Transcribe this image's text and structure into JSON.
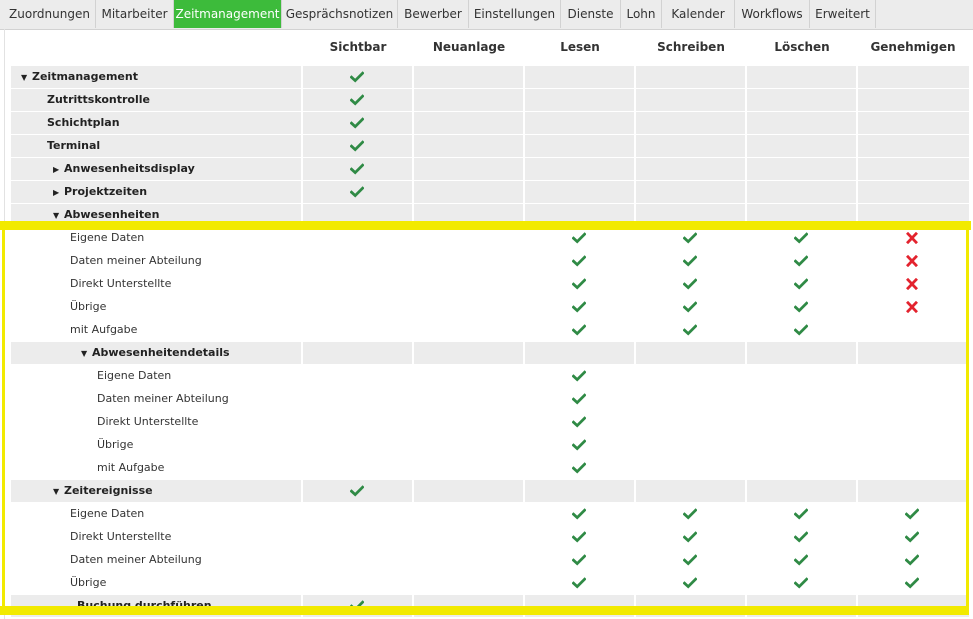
{
  "tabs": [
    "Zuordnungen",
    "Mitarbeiter",
    "Zeitmanagement",
    "Gesprächsnotizen",
    "Bewerber",
    "Einstellungen",
    "Dienste",
    "Lohn",
    "Kalender",
    "Workflows",
    "Erweitert"
  ],
  "active_tab": "Zeitmanagement",
  "columns": [
    "Sichtbar",
    "Neuanlage",
    "Lesen",
    "Schreiben",
    "Löschen",
    "Genehmigen"
  ],
  "colors": {
    "accent": "#3dbb3b",
    "check": "#2f8a45",
    "cross": "#e3232e",
    "highlight": "#f2ea00",
    "row_shade": "#ececec"
  },
  "rows": [
    {
      "label": "Zeitmanagement",
      "level": 0,
      "bold": true,
      "expander": "expanded",
      "shaded": true,
      "cells": [
        "check",
        "",
        "",
        "",
        "",
        ""
      ]
    },
    {
      "label": "Zutrittskontrolle",
      "level": 1,
      "bold": true,
      "expander": "none",
      "shaded": true,
      "cells": [
        "check",
        "",
        "",
        "",
        "",
        ""
      ]
    },
    {
      "label": "Schichtplan",
      "level": 1,
      "bold": true,
      "expander": "none",
      "shaded": true,
      "cells": [
        "check",
        "",
        "",
        "",
        "",
        ""
      ]
    },
    {
      "label": "Terminal",
      "level": 1,
      "bold": true,
      "expander": "none",
      "shaded": true,
      "cells": [
        "check",
        "",
        "",
        "",
        "",
        ""
      ]
    },
    {
      "label": "Anwesenheitsdisplay",
      "level": 2,
      "bold": true,
      "expander": "collapsed",
      "shaded": true,
      "cells": [
        "check",
        "",
        "",
        "",
        "",
        ""
      ]
    },
    {
      "label": "Projektzeiten",
      "level": 2,
      "bold": true,
      "expander": "collapsed",
      "shaded": true,
      "cells": [
        "check",
        "",
        "",
        "",
        "",
        ""
      ]
    },
    {
      "label": "Abwesenheiten",
      "level": 2,
      "bold": true,
      "expander": "expanded",
      "shaded": true,
      "cells": [
        "",
        "",
        "",
        "",
        "",
        ""
      ]
    },
    {
      "label": "Eigene Daten",
      "level": 3,
      "bold": false,
      "expander": "none",
      "shaded": false,
      "cells": [
        "",
        "",
        "check",
        "check",
        "check",
        "cross"
      ]
    },
    {
      "label": "Daten meiner Abteilung",
      "level": 3,
      "bold": false,
      "expander": "none",
      "shaded": false,
      "cells": [
        "",
        "",
        "check",
        "check",
        "check",
        "cross"
      ]
    },
    {
      "label": "Direkt Unterstellte",
      "level": 3,
      "bold": false,
      "expander": "none",
      "shaded": false,
      "cells": [
        "",
        "",
        "check",
        "check",
        "check",
        "cross"
      ]
    },
    {
      "label": "Übrige",
      "level": 3,
      "bold": false,
      "expander": "none",
      "shaded": false,
      "cells": [
        "",
        "",
        "check",
        "check",
        "check",
        "cross"
      ]
    },
    {
      "label": "mit Aufgabe",
      "level": 3,
      "bold": false,
      "expander": "none",
      "shaded": false,
      "cells": [
        "",
        "",
        "check",
        "check",
        "check",
        ""
      ]
    },
    {
      "label": "Abwesenheitendetails",
      "level": 4,
      "bold": true,
      "expander": "expanded",
      "shaded": true,
      "cells": [
        "",
        "",
        "",
        "",
        "",
        ""
      ]
    },
    {
      "label": "Eigene Daten",
      "level": 5,
      "bold": false,
      "expander": "none",
      "shaded": false,
      "cells": [
        "",
        "",
        "check",
        "",
        "",
        ""
      ]
    },
    {
      "label": "Daten meiner Abteilung",
      "level": 5,
      "bold": false,
      "expander": "none",
      "shaded": false,
      "cells": [
        "",
        "",
        "check",
        "",
        "",
        ""
      ]
    },
    {
      "label": "Direkt Unterstellte",
      "level": 5,
      "bold": false,
      "expander": "none",
      "shaded": false,
      "cells": [
        "",
        "",
        "check",
        "",
        "",
        ""
      ]
    },
    {
      "label": "Übrige",
      "level": 5,
      "bold": false,
      "expander": "none",
      "shaded": false,
      "cells": [
        "",
        "",
        "check",
        "",
        "",
        ""
      ]
    },
    {
      "label": "mit Aufgabe",
      "level": 5,
      "bold": false,
      "expander": "none",
      "shaded": false,
      "cells": [
        "",
        "",
        "check",
        "",
        "",
        ""
      ]
    },
    {
      "label": "Zeitereignisse",
      "level": 2,
      "bold": true,
      "expander": "expanded",
      "shaded": true,
      "cells": [
        "check",
        "",
        "",
        "",
        "",
        ""
      ]
    },
    {
      "label": "Eigene Daten",
      "level": 3,
      "bold": false,
      "expander": "none",
      "shaded": false,
      "cells": [
        "",
        "",
        "check",
        "check",
        "check",
        "check"
      ]
    },
    {
      "label": "Direkt Unterstellte",
      "level": 3,
      "bold": false,
      "expander": "none",
      "shaded": false,
      "cells": [
        "",
        "",
        "check",
        "check",
        "check",
        "check"
      ]
    },
    {
      "label": "Daten meiner Abteilung",
      "level": 3,
      "bold": false,
      "expander": "none",
      "shaded": false,
      "cells": [
        "",
        "",
        "check",
        "check",
        "check",
        "check"
      ]
    },
    {
      "label": "Übrige",
      "level": 3,
      "bold": false,
      "expander": "none",
      "shaded": false,
      "cells": [
        "",
        "",
        "check",
        "check",
        "check",
        "check"
      ]
    },
    {
      "label": "Buchung durchführen",
      "level": 6,
      "bold": true,
      "expander": "none",
      "shaded": true,
      "cells": [
        "check",
        "",
        "",
        "",
        "",
        ""
      ]
    }
  ]
}
